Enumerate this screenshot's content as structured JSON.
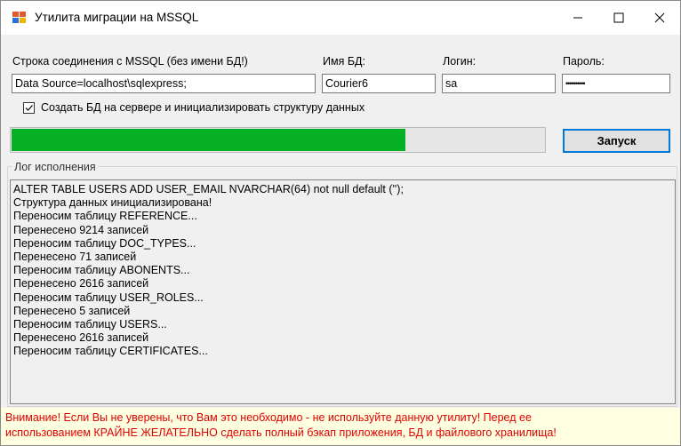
{
  "window": {
    "title": "Утилита миграции на MSSQL",
    "icon": "app-grid-icon",
    "controls": {
      "minimize": "minimize-icon",
      "maximize": "maximize-icon",
      "close": "close-icon"
    }
  },
  "form": {
    "connection": {
      "label": "Строка соединения с MSSQL (без имени БД!)",
      "value": "Data Source=localhost\\sqlexpress;"
    },
    "db_name": {
      "label": "Имя БД:",
      "value": "Courier6"
    },
    "login": {
      "label": "Логин:",
      "value": "sa"
    },
    "password": {
      "label": "Пароль:",
      "value": "••••••••••"
    },
    "create_db": {
      "label": "Создать БД на сервере и инициализировать структуру данных",
      "checked": true
    },
    "progress_percent": 74,
    "run_label": "Запуск"
  },
  "log": {
    "title": "Лог исполнения",
    "lines": [
      "ALTER TABLE USERS ADD USER_EMAIL NVARCHAR(64) not null default ('');",
      "Структура данных инициализирована!",
      "Переносим таблицу REFERENCE...",
      "Перенесено 9214 записей",
      "Переносим таблицу DOC_TYPES...",
      "Перенесено 71 записей",
      "Переносим таблицу ABONENTS...",
      "Перенесено 2616 записей",
      "Переносим таблицу USER_ROLES...",
      "Перенесено 5 записей",
      "Переносим таблицу USERS...",
      "Перенесено 2616 записей",
      "Переносим таблицу CERTIFICATES..."
    ]
  },
  "warning": {
    "line1": "Внимание! Если Вы не уверены, что Вам это необходимо - не используйте данную утилиту! Перед ее",
    "line2": "использованием КРАЙНЕ ЖЕЛАТЕЛЬНО сделать полный бэкап приложения, БД и файлового хранилища!"
  },
  "colors": {
    "progress": "#06b025",
    "warning_text": "#e00000",
    "warning_bg": "#ffffe1",
    "focus": "#0078d7"
  }
}
